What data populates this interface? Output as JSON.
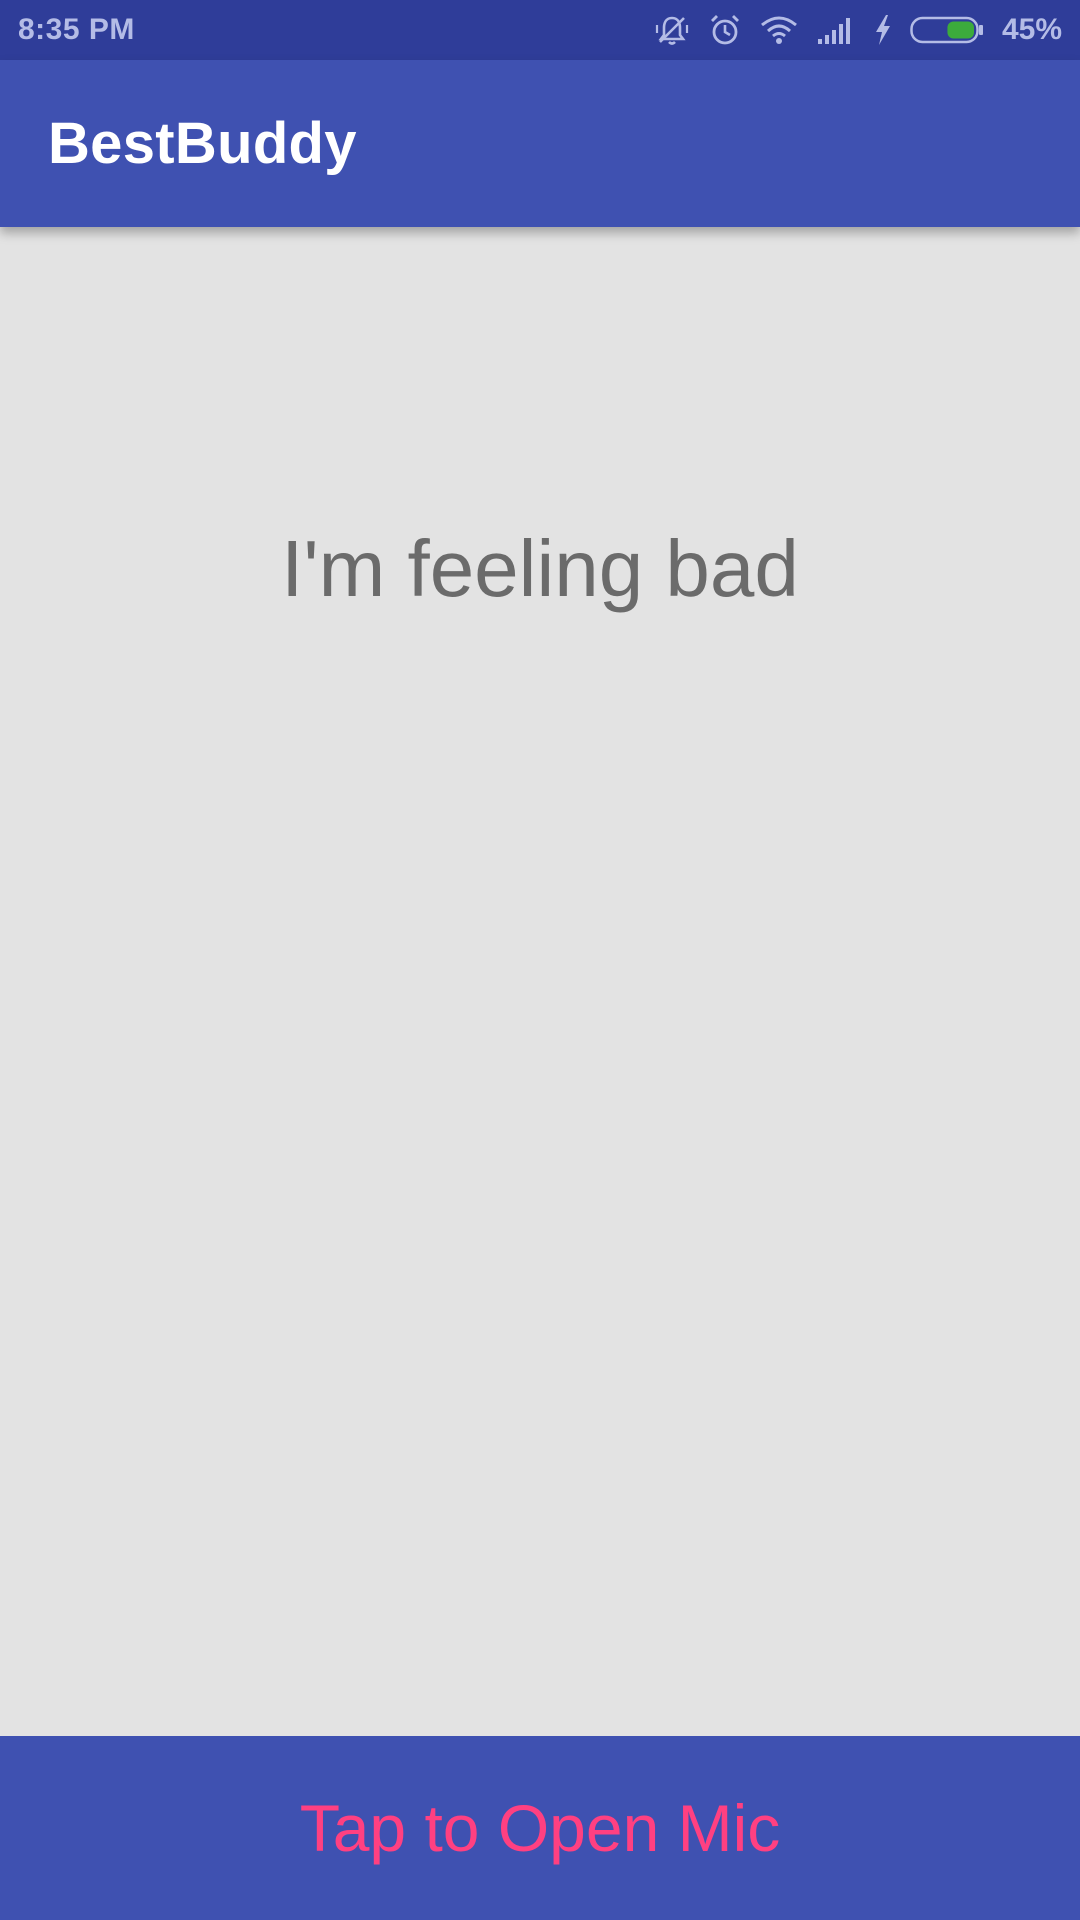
{
  "status_bar": {
    "time": "8:35 PM",
    "battery_percent": "45%",
    "battery_level": 0.45,
    "battery_color": "#3cab3c",
    "icons": [
      "vibrate-off-icon",
      "alarm-icon",
      "wifi-icon",
      "signal-icon",
      "charging-icon",
      "battery-icon"
    ]
  },
  "app_bar": {
    "title": "BestBuddy",
    "color": "#3f51b1"
  },
  "main": {
    "message": "I'm feeling bad"
  },
  "mic_button": {
    "label": "Tap to Open Mic",
    "text_color": "#ff4081"
  }
}
